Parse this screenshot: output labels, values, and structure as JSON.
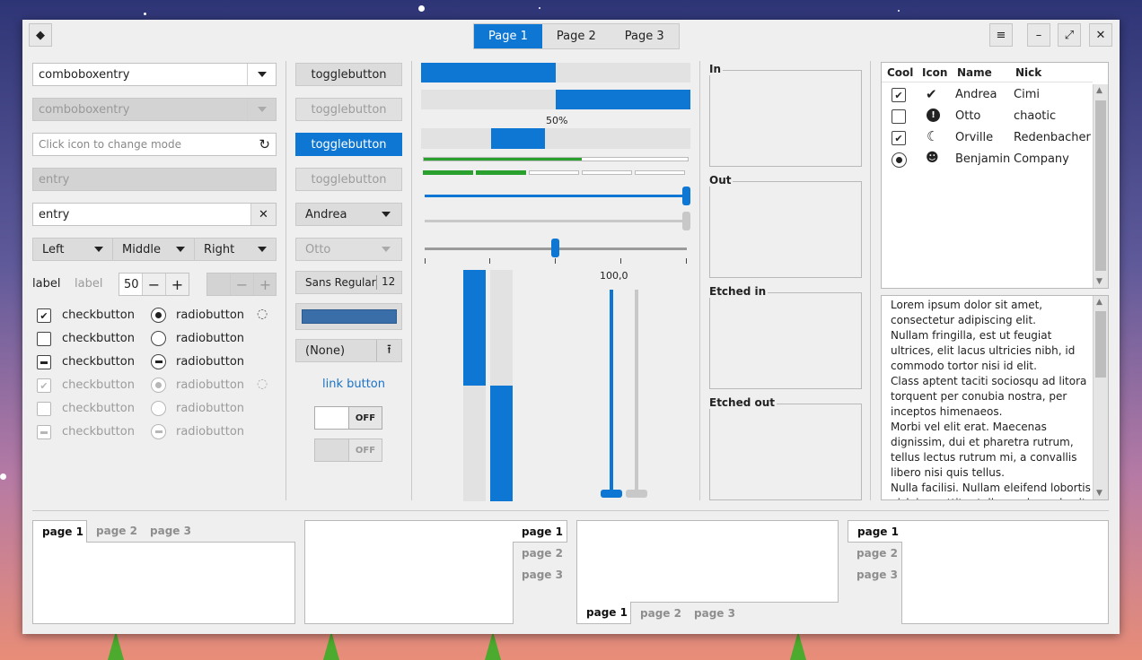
{
  "window": {
    "tabs": [
      "Page 1",
      "Page 2",
      "Page 3"
    ],
    "active_tab": 0
  },
  "icons": {
    "app": "app-icon",
    "menu": "hamburger-icon",
    "minimize": "minimize-icon",
    "maximize": "maximize-icon",
    "close": "close-icon"
  },
  "col1": {
    "combo1": "comboboxentry",
    "combo2": "comboboxentry",
    "mode_placeholder": "Click icon to change mode",
    "entry_disabled": "entry",
    "entry": "entry",
    "combos": [
      "Left",
      "Middle",
      "Right"
    ],
    "label1": "label",
    "label2": "label",
    "spin_value": "50",
    "checks": [
      "checkbutton",
      "checkbutton",
      "checkbutton",
      "checkbutton",
      "checkbutton",
      "checkbutton"
    ],
    "radios": [
      "radiobutton",
      "radiobutton",
      "radiobutton",
      "radiobutton",
      "radiobutton",
      "radiobutton"
    ]
  },
  "col2": {
    "toggles": [
      "togglebutton",
      "togglebutton",
      "togglebutton",
      "togglebutton"
    ],
    "combo_andrea": "Andrea",
    "combo_otto": "Otto",
    "font_name": "Sans Regular",
    "font_size": "12",
    "color_value": "#3a6ea8",
    "file": "(None)",
    "link": "link button",
    "switch1": "OFF",
    "switch2": "OFF"
  },
  "col3": {
    "progress_label": "50%",
    "scale_value": "100,0",
    "progress_fraction": 0.5,
    "green_level": 0.6
  },
  "frames": [
    "In",
    "Out",
    "Etched in",
    "Etched out"
  ],
  "tree": {
    "headers": [
      "Cool",
      "Icon",
      "Name",
      "Nick"
    ],
    "rows": [
      {
        "cool": "checked",
        "icon": "checkmark-icon",
        "name": "Andrea",
        "nick": "Cimi"
      },
      {
        "cool": "unchecked",
        "icon": "warning-icon",
        "name": "Otto",
        "nick": "chaotic"
      },
      {
        "cool": "checked",
        "icon": "moon-icon",
        "name": "Orville",
        "nick": "Redenbacher"
      },
      {
        "cool": "radio",
        "icon": "person-icon",
        "name": "Benjamin",
        "nick": "Company"
      }
    ]
  },
  "text_view": [
    "Lorem ipsum dolor sit amet,",
    "consectetur adipiscing elit.",
    "Nullam fringilla, est ut feugiat",
    "ultrices, elit lacus ultricies nibh, id",
    "commodo tortor nisi id elit.",
    "Class aptent taciti sociosqu ad litora",
    "torquent per conubia nostra, per",
    "inceptos himenaeos.",
    "Morbi vel elit erat. Maecenas",
    "dignissim, dui et pharetra rutrum,",
    "tellus lectus rutrum mi, a convallis",
    "libero nisi quis tellus.",
    "Nulla facilisi. Nullam eleifend lobortis",
    "nisl, in porttitor tellus malesuada vitae"
  ],
  "notebooks": [
    [
      "page 1",
      "page 2",
      "page 3"
    ],
    [
      "page 1",
      "page 2",
      "page 3"
    ],
    [
      "page 1",
      "page 2",
      "page 3"
    ],
    [
      "page 1",
      "page 2",
      "page 3"
    ]
  ]
}
